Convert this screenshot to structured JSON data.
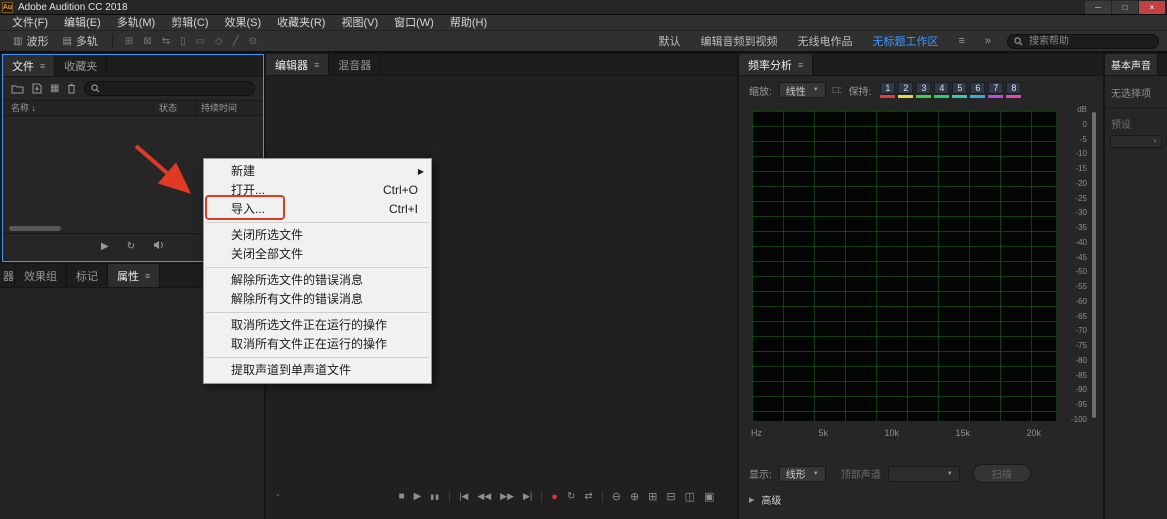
{
  "colors": {
    "accent_blue": "#4098ff",
    "record_red": "#d23b2f",
    "annotation_red": "#e03a24",
    "hold_colors": [
      "#e23b3b",
      "#e7d93b",
      "#43d043",
      "#35c96e",
      "#35c9b0",
      "#3aa8e0",
      "#c04ae0",
      "#e04ab0"
    ]
  },
  "titlebar": {
    "app_icon": "Au",
    "title": "Adobe Audition CC 2018"
  },
  "window_controls": {
    "minimize": "─",
    "maximize": "□",
    "close": "×"
  },
  "menubar": {
    "items": [
      "文件(F)",
      "编辑(E)",
      "多轨(M)",
      "剪辑(C)",
      "效果(S)",
      "收藏夹(R)",
      "视图(V)",
      "窗口(W)",
      "帮助(H)"
    ]
  },
  "toolbar": {
    "waveform_label": "波形",
    "multitrack_label": "多轨",
    "tool_glyphs": [
      "⊞",
      "⊠",
      "⇆",
      "▯",
      "▭",
      "◇",
      "╱",
      "⊙"
    ],
    "workspaces": [
      "默认",
      "编辑音频到视频",
      "无线电作品",
      "无标题工作区"
    ],
    "active_workspace": "无标题工作区",
    "search_placeholder": "搜索帮助"
  },
  "files_panel": {
    "tabs": [
      "文件",
      "收藏夹"
    ],
    "columns": [
      "名称",
      "状态",
      "持续时间"
    ]
  },
  "lower_panel": {
    "tabs": [
      "器",
      "效果组",
      "标记",
      "属性"
    ],
    "active_tab": "属性"
  },
  "editor_panel": {
    "tabs": [
      "编辑器",
      "混音器"
    ],
    "active_tab": "编辑器",
    "time_display": "-"
  },
  "context_menu": {
    "items": [
      {
        "label": "新建",
        "shortcut": "",
        "has_submenu": true
      },
      {
        "label": "打开...",
        "shortcut": "Ctrl+O"
      },
      {
        "label": "导入...",
        "shortcut": "Ctrl+I"
      },
      {
        "label": "关闭所选文件",
        "shortcut": ""
      },
      {
        "label": "关闭全部文件",
        "shortcut": ""
      },
      {
        "label": "解除所选文件的错误消息",
        "shortcut": ""
      },
      {
        "label": "解除所有文件的错误消息",
        "shortcut": ""
      },
      {
        "label": "取消所选文件正在运行的操作",
        "shortcut": ""
      },
      {
        "label": "取消所有文件正在运行的操作",
        "shortcut": ""
      },
      {
        "label": "提取声道到单声道文件",
        "shortcut": ""
      }
    ]
  },
  "freq_panel": {
    "title": "频率分析",
    "zoom_label": "缩放:",
    "zoom_value": "线性",
    "hold_label": "保持:",
    "hold_buttons": [
      "1",
      "2",
      "3",
      "4",
      "5",
      "6",
      "7",
      "8"
    ],
    "db_labels": [
      "dB",
      "0",
      "-5",
      "-10",
      "-15",
      "-20",
      "-25",
      "-30",
      "-35",
      "-40",
      "-45",
      "-50",
      "-55",
      "-60",
      "-65",
      "-70",
      "-75",
      "-80",
      "-85",
      "-90",
      "-95",
      "-100"
    ],
    "hz_labels": [
      "Hz",
      "5k",
      "10k",
      "15k",
      "20k"
    ],
    "display_label": "显示:",
    "display_value": "线形",
    "top_channel_label": "顶部声道",
    "scan_button_label": "扫描",
    "advanced_label": "高级"
  },
  "basic_sound_panel": {
    "title": "基本声音",
    "no_selection": "无选择项",
    "preset_label": "预设"
  },
  "icons": {
    "panel_menu": "≡",
    "submenu_arrow": "▶",
    "dropdown_arrow": "▼",
    "sort_descending": "↓",
    "double_chevron": "»",
    "copy_settings": "□:",
    "media_browser": "▦",
    "waveform_view": "▥",
    "multitrack_view": "▤",
    "stop": "■",
    "play": "▶",
    "pause": "▮▮",
    "skip_back": "|◀",
    "rewind": "◀◀",
    "fast_forward": "▶▶",
    "skip_forward": "▶|",
    "record": "●",
    "loop": "↻",
    "skip_selection": "⇄",
    "zoom_out": "⊖",
    "zoom_in": "⊕",
    "zoom_out_h": "⊟",
    "zoom_in_h": "⊞",
    "zoom_selection": "◫",
    "zoom_full": "▣",
    "advanced_arrow": "▶"
  }
}
